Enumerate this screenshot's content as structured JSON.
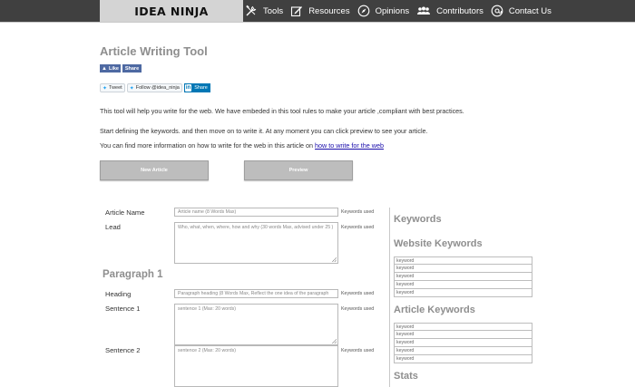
{
  "nav": {
    "logo": "IDEA NINJA",
    "items": [
      {
        "label": "Tools",
        "icon": "tools-icon"
      },
      {
        "label": "Resources",
        "icon": "edit-icon"
      },
      {
        "label": "Opinions",
        "icon": "compass-icon"
      },
      {
        "label": "Contributors",
        "icon": "people-icon"
      },
      {
        "label": "Contact Us",
        "icon": "at-icon"
      }
    ]
  },
  "header": {
    "title": "Article Writing Tool",
    "fb_like": "Like",
    "fb_share": "Share",
    "tweet": "Tweet",
    "follow": "Follow @idea_ninja",
    "li_share": "Share"
  },
  "intro": {
    "p1": "This tool will help you write for the web. We have embeded in this tool rules to make your article ,compliant with best practices.",
    "p2": "Start defining the keywords. and then move on to write it. At any moment you can click preview to see your article.",
    "p3_prefix": "You can find more information on how to write for the web in this article on ",
    "p3_link": "how to write for the web"
  },
  "actions": {
    "new_article": "New Article",
    "preview": "Preview"
  },
  "form": {
    "keywords_used": "Keywords used",
    "article_name_label": "Article Name",
    "article_name_placeholder": "Article name (8 Words Max)",
    "lead_label": "Lead",
    "lead_placeholder": "Who, what, when, where, how and why (30 words Max, advised under 25 )",
    "paragraph_title": "Paragraph 1",
    "heading_label": "Heading",
    "heading_placeholder": "Paragraph heading (8 Words Max, Reflect the one idea of the paragraph",
    "sentence1_label": "Sentence 1",
    "sentence1_placeholder": "sentence 1 (Max: 20 words)",
    "sentence2_label": "Sentence 2",
    "sentence2_placeholder": "sentence 2 (Max: 20 words)"
  },
  "sidebar": {
    "keywords_title": "Keywords",
    "website_keywords_title": "Website Keywords",
    "article_keywords_title": "Article Keywords",
    "stats_title": "Stats",
    "keyword_placeholder": "keyword",
    "website_keywords": [
      "keyword",
      "keyword",
      "keyword",
      "keyword",
      "keyword"
    ],
    "article_keywords": [
      "keyword",
      "keyword",
      "keyword",
      "keyword",
      "keyword"
    ]
  },
  "colors": {
    "nav_bg": "#404040",
    "logo_bg": "#d4d4d4",
    "heading_gray": "#8e8e8e",
    "button_gray": "#bdbdbd",
    "facebook_blue": "#4e69a2",
    "linkedin_blue": "#0077b5",
    "link_blue": "#1a0dab"
  }
}
